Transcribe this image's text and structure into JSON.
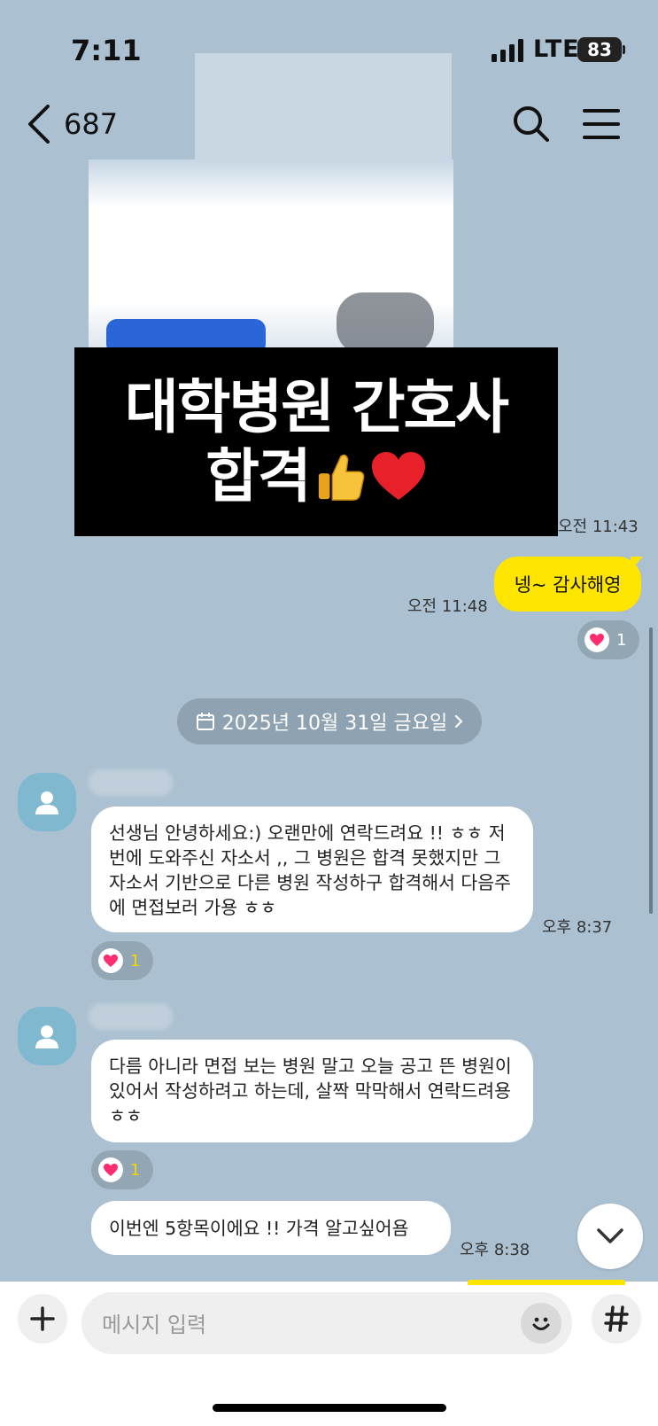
{
  "status": {
    "time": "7:11",
    "network": "LTE",
    "battery": "83"
  },
  "header": {
    "title": "687",
    "back_icon": "chevron-left-icon",
    "search_icon": "search-icon",
    "menu_icon": "hamburger-menu-icon"
  },
  "caption": {
    "line1": "대학병원 간호사",
    "line2": "합격"
  },
  "messages": {
    "first_time": "오전 11:43",
    "mine": {
      "text": "넹~ 감사해영",
      "time": "오전 11:48",
      "reaction_count": "1"
    },
    "date_chip": "2025년 10월 31일 금요일",
    "other1": {
      "text": "선생님 안녕하세요:) 오랜만에 연락드려요 !! ㅎㅎ 저번에 도와주신 자소서 ,, 그 병원은 합격 못했지만 그 자소서 기반으로 다른 병원 작성하구 합격해서 다음주에 면접보러 가용 ㅎㅎ",
      "time": "오후 8:37",
      "reaction_count": "1"
    },
    "other2": {
      "text": "다름 아니라 면접 보는 병원 말고 오늘 공고 뜬 병원이 있어서 작성하려고 하는데, 살짝 막막해서 연락드려용 ㅎㅎ",
      "reaction_count": "1"
    },
    "other3": {
      "text": "이번엔 5항목이에요 !! 가격 알고싶어욤",
      "time": "오후 8:38"
    }
  },
  "input": {
    "placeholder": "메시지 입력"
  },
  "colors": {
    "background": "#abc1d1",
    "my_bubble": "#fee500",
    "other_bubble": "#ffffff",
    "heart": "#ff2d6f"
  }
}
